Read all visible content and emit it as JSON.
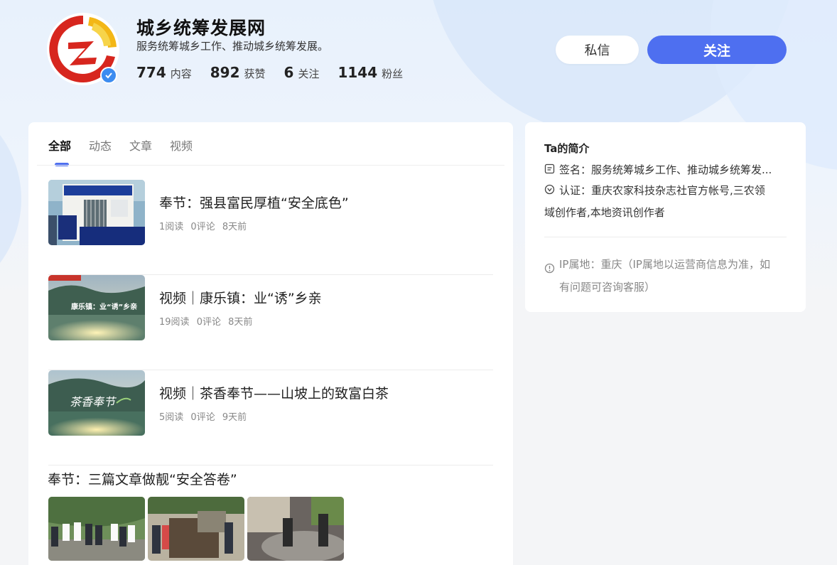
{
  "profile": {
    "name": "城乡统筹发展网",
    "description": "服务统筹城乡工作、推动城乡统筹发展。",
    "stats": [
      {
        "value": "774",
        "label": "内容"
      },
      {
        "value": "892",
        "label": "获赞"
      },
      {
        "value": "6",
        "label": "关注"
      },
      {
        "value": "1144",
        "label": "粉丝"
      }
    ]
  },
  "actions": {
    "message_label": "私信",
    "follow_label": "关注"
  },
  "tabs": [
    {
      "label": "全部",
      "active": true
    },
    {
      "label": "动态",
      "active": false
    },
    {
      "label": "文章",
      "active": false
    },
    {
      "label": "视频",
      "active": false
    }
  ],
  "feed": [
    {
      "title": "奉节：强县富民厚植“安全底色”",
      "reads": "1阅读",
      "comments": "0评论",
      "time": "8天前"
    },
    {
      "title": "视频｜康乐镇：业“诱”乡亲",
      "reads": "19阅读",
      "comments": "0评论",
      "time": "8天前",
      "thumb_text": "康乐镇：业“诱”乡亲"
    },
    {
      "title": "视频｜茶香奉节——山坡上的致富白茶",
      "reads": "5阅读",
      "comments": "0评论",
      "time": "9天前",
      "thumb_text": "茶香奉节"
    }
  ],
  "article": {
    "title": "奉节：三篇文章做靓“安全答卷”"
  },
  "intro": {
    "title": "Ta的简介",
    "signature": "签名：服务统筹城乡工作、推动城乡统筹发...",
    "certification_line1": "认证：重庆农家科技杂志社官方帐号,三农领",
    "certification_line2": "域创作者,本地资讯创作者",
    "ip_line1": "IP属地：重庆（IP属地以运营商信息为准，如",
    "ip_line2": "有问题可咨询客服）"
  },
  "colors": {
    "accent": "#4e6ff0",
    "verified": "#3c8cf0"
  }
}
